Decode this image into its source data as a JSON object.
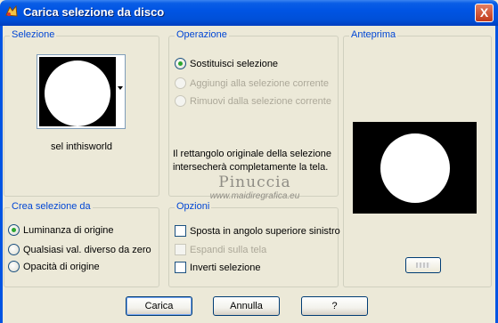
{
  "window": {
    "title": "Carica selezione da disco",
    "close_glyph": "X",
    "icon": "paint-shop-pro-icon"
  },
  "selezione": {
    "legend": "Selezione",
    "file_name": "sel inthisworld"
  },
  "operazione": {
    "legend": "Operazione",
    "options": [
      {
        "label": "Sostituisci selezione",
        "checked": true,
        "enabled": true
      },
      {
        "label": "Aggiungi alla selezione corrente",
        "checked": false,
        "enabled": false
      },
      {
        "label": "Rimuovi dalla selezione corrente",
        "checked": false,
        "enabled": false
      }
    ],
    "info": "Il rettangolo originale della selezione intersecherà completamente la tela."
  },
  "anteprima": {
    "legend": "Anteprima"
  },
  "crea": {
    "legend": "Crea selezione da",
    "options": [
      {
        "label": "Luminanza di origine",
        "checked": true
      },
      {
        "label": "Qualsiasi val. diverso da zero",
        "checked": false
      },
      {
        "label": "Opacità di origine",
        "checked": false
      }
    ]
  },
  "opzioni": {
    "legend": "Opzioni",
    "options": [
      {
        "label": "Sposta in angolo superiore sinistro",
        "checked": false,
        "enabled": true
      },
      {
        "label": "Espandi sulla tela",
        "checked": false,
        "enabled": false
      },
      {
        "label": "Inverti selezione",
        "checked": false,
        "enabled": true
      }
    ]
  },
  "watermark": {
    "line1": "Pinuccia",
    "line2": "www.maidiregrafica.eu"
  },
  "buttons": {
    "ok": "Carica",
    "cancel": "Annulla",
    "help": "?"
  },
  "colors": {
    "title_bar": "#0054e3",
    "legend_text": "#0046d5",
    "dialog_bg": "#ece9d8"
  }
}
